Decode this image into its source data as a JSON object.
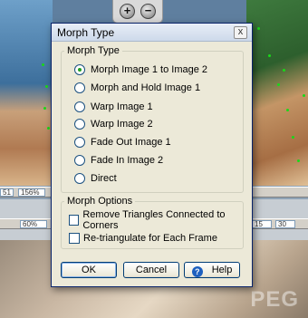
{
  "dialog": {
    "title": "Morph Type",
    "close_glyph": "x",
    "morph_type": {
      "heading": "Morph Type",
      "options": [
        {
          "label": "Morph Image 1 to Image 2",
          "selected": true
        },
        {
          "label": "Morph and Hold Image 1",
          "selected": false
        },
        {
          "label": "Warp Image 1",
          "selected": false
        },
        {
          "label": "Warp Image 2",
          "selected": false
        },
        {
          "label": "Fade Out Image 1",
          "selected": false
        },
        {
          "label": "Fade In Image 2",
          "selected": false
        },
        {
          "label": "Direct",
          "selected": false
        }
      ]
    },
    "morph_options": {
      "heading": "Morph Options",
      "checkboxes": [
        {
          "label": "Remove Triangles Connected to Corners",
          "checked": false
        },
        {
          "label": "Re-triangulate for Each Frame",
          "checked": false
        }
      ]
    },
    "buttons": {
      "ok": "OK",
      "cancel": "Cancel",
      "help": "Help",
      "help_icon_glyph": "?"
    }
  },
  "background": {
    "zoom_in_glyph": "+",
    "zoom_out_glyph": "−",
    "top_bar_fields": [
      "51",
      "156%"
    ],
    "lower_bar_fields": [
      "60%",
      "15",
      "30"
    ],
    "watermark": "PEG"
  },
  "colors": {
    "dialog_face": "#ece9d8",
    "radio_dot": "#21a121",
    "point_markers": "#19d919"
  }
}
